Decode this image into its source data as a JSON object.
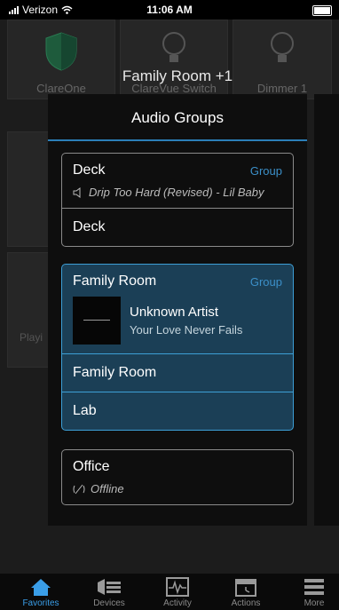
{
  "status_bar": {
    "carrier": "Verizon",
    "time": "11:06 AM"
  },
  "background": {
    "tiles": [
      {
        "label": "ClareOne",
        "icon": "shield-icon"
      },
      {
        "label": "ClareVue Switch",
        "icon": "lightbulb-icon"
      },
      {
        "label": "Dimmer 1",
        "icon": "lightbulb-icon"
      }
    ],
    "room_title": "Family Room +1",
    "playing_label": "Playi"
  },
  "modal": {
    "title": "Audio Groups",
    "groups": [
      {
        "name": "Deck",
        "action": "Group",
        "status_icon": "speaker-icon",
        "status": "Drip Too Hard (Revised) - Lil Baby",
        "members": [
          "Deck"
        ]
      },
      {
        "name": "Family Room",
        "action": "Group",
        "now_playing": {
          "artist": "Unknown Artist",
          "song": "Your Love Never Fails"
        },
        "members": [
          "Family Room",
          "Lab"
        ],
        "selected": true
      },
      {
        "name": "Office",
        "status_icon": "offline-speaker-icon",
        "status": "Offline"
      }
    ]
  },
  "tabbar": {
    "tabs": [
      {
        "label": "Favorites",
        "icon": "home-icon",
        "active": true
      },
      {
        "label": "Devices",
        "icon": "devices-icon"
      },
      {
        "label": "Activity",
        "icon": "activity-icon"
      },
      {
        "label": "Actions",
        "icon": "calendar-icon"
      },
      {
        "label": "More",
        "icon": "menu-icon"
      }
    ]
  },
  "colors": {
    "accent": "#3b8fc8",
    "selected_bg": "#1b3f56",
    "selected_border": "#3d9fd6"
  }
}
